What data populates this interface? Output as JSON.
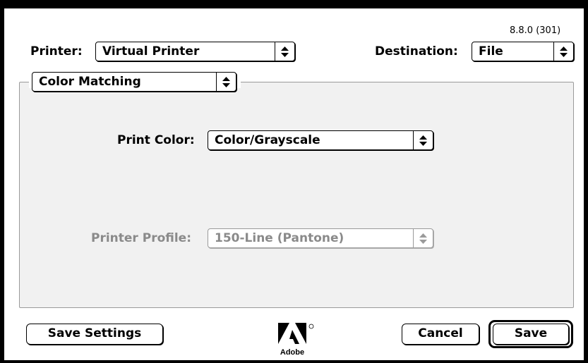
{
  "version": "8.8.0 (301)",
  "header": {
    "printer_label": "Printer:",
    "printer_value": "Virtual Printer",
    "destination_label": "Destination:",
    "destination_value": "File"
  },
  "panel": {
    "panel_value": "Color Matching",
    "print_color_label": "Print Color:",
    "print_color_value": "Color/Grayscale",
    "printer_profile_label": "Printer Profile:",
    "printer_profile_value": "150-Line (Pantone)"
  },
  "footer": {
    "save_settings_label": "Save Settings",
    "cancel_label": "Cancel",
    "save_label": "Save",
    "logo_text": "Adobe"
  },
  "icons": {
    "popup_arrows": "up-down-arrows-icon",
    "logo": "adobe-logo-icon"
  }
}
